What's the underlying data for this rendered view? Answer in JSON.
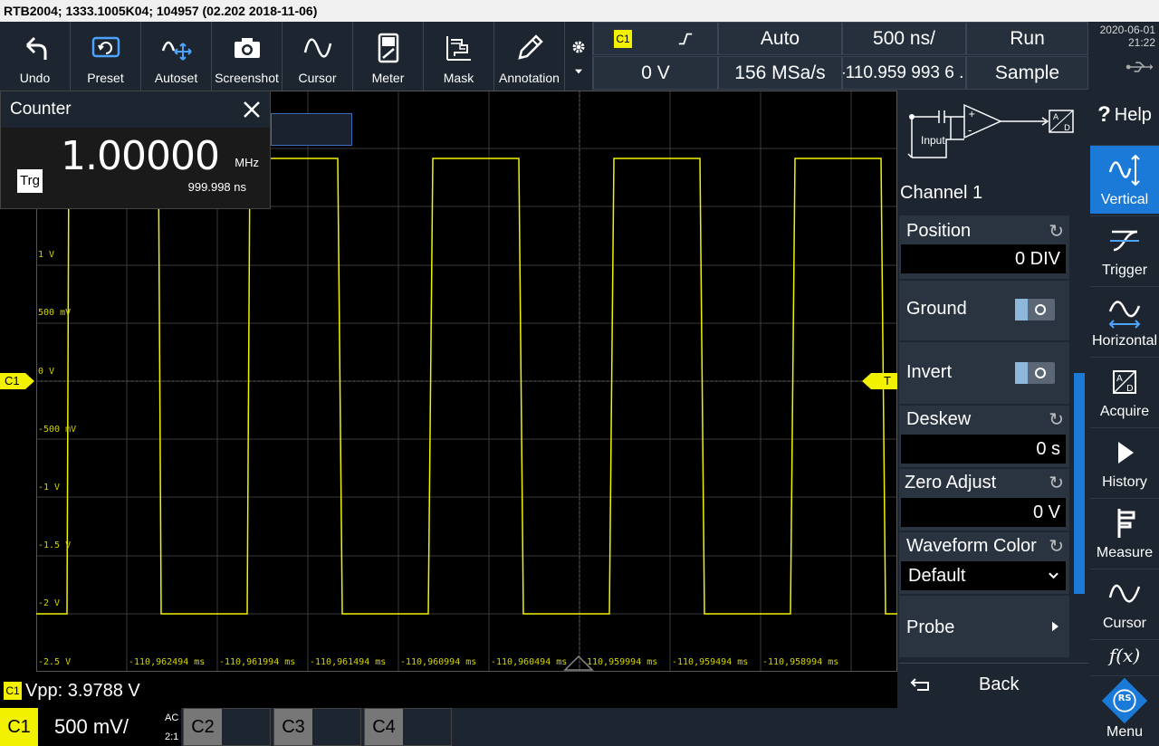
{
  "title": "RTB2004; 1333.1005K04; 104957 (02.202 2018-11-06)",
  "toolbar": {
    "undo": "Undo",
    "preset": "Preset",
    "autoset": "Autoset",
    "screenshot": "Screenshot",
    "cursor": "Cursor",
    "meter": "Meter",
    "mask": "Mask",
    "annotation": "Annotation"
  },
  "status": {
    "channel_tag": "C1",
    "trigger_mode": "Auto",
    "timebase": "500 ns/",
    "run_state": "Run",
    "trigger_level": "0 V",
    "sample_rate": "156 MSa/s",
    "time_offset": "-110.959 993 6 ..",
    "acq_mode": "Sample"
  },
  "datetime": {
    "date": "2020-06-01",
    "time": "21:22"
  },
  "counter": {
    "title": "Counter",
    "value": "1.00000",
    "unit": "MHz",
    "period": "999.998 ns",
    "trg_label": "Trg"
  },
  "y_labels": [
    "1 V",
    "500 mV",
    "0 V",
    "-500 mV",
    "-1 V",
    "-1.5 V",
    "-2 V",
    "-2.5 V"
  ],
  "x_labels": [
    "-110,962494 ms",
    "-110,961994 ms",
    "-110,961494 ms",
    "-110,960994 ms",
    "-110,960494 ms",
    "-110,959994 ms",
    "-110,959494 ms",
    "-110,958994 ms"
  ],
  "markers": {
    "left": "C1",
    "right": "T"
  },
  "measurement": {
    "tag": "C1",
    "text": "Vpp: 3.9788 V"
  },
  "channels": {
    "c1": {
      "label": "C1",
      "scale": "500 mV/",
      "coupling": "AC",
      "probe": "2:1"
    },
    "c2": {
      "label": "C2"
    },
    "c3": {
      "label": "C3"
    },
    "c4": {
      "label": "C4"
    }
  },
  "menu": {
    "diagram_input": "Input",
    "channel_name": "Channel 1",
    "position": {
      "label": "Position",
      "value": "0 DIV"
    },
    "ground": {
      "label": "Ground"
    },
    "invert": {
      "label": "Invert"
    },
    "deskew": {
      "label": "Deskew",
      "value": "0 s"
    },
    "zero_adjust": {
      "label": "Zero Adjust",
      "value": "0 V"
    },
    "waveform_color": {
      "label": "Waveform Color",
      "value": "Default"
    },
    "probe": {
      "label": "Probe"
    },
    "back": "Back"
  },
  "side": {
    "help": "Help",
    "vertical": "Vertical",
    "trigger": "Trigger",
    "horizontal": "Horizontal",
    "acquire": "Acquire",
    "history": "History",
    "measure": "Measure",
    "cursor": "Cursor",
    "fx": "f(x)",
    "menu": "Menu",
    "logo": "RS"
  },
  "colors": {
    "waveform": "#f2f200",
    "accent": "#1b7ad8",
    "panel": "#1c2530"
  }
}
